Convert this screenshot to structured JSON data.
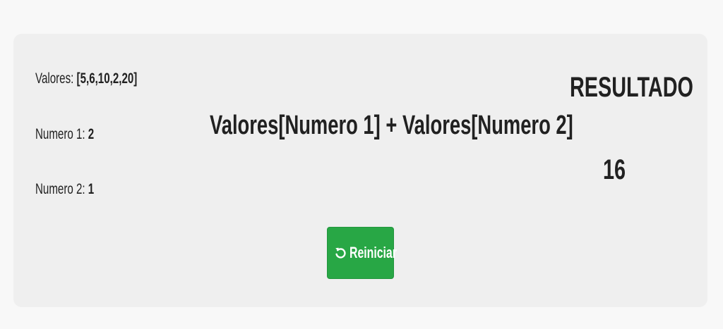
{
  "params": {
    "valores_label": "Valores: ",
    "valores_value": "[5,6,10,2,20]",
    "numero1_label": "Numero 1: ",
    "numero1_value": "2",
    "numero2_label": "Numero 2: ",
    "numero2_value": "1"
  },
  "formula": "Valores[Numero 1] + Valores[Numero 2]",
  "result": {
    "title": "RESULTADO",
    "value": "16"
  },
  "reset_button": {
    "label": "Reiniciar",
    "icon": "rotate-ccw-icon",
    "color": "#28a745"
  }
}
